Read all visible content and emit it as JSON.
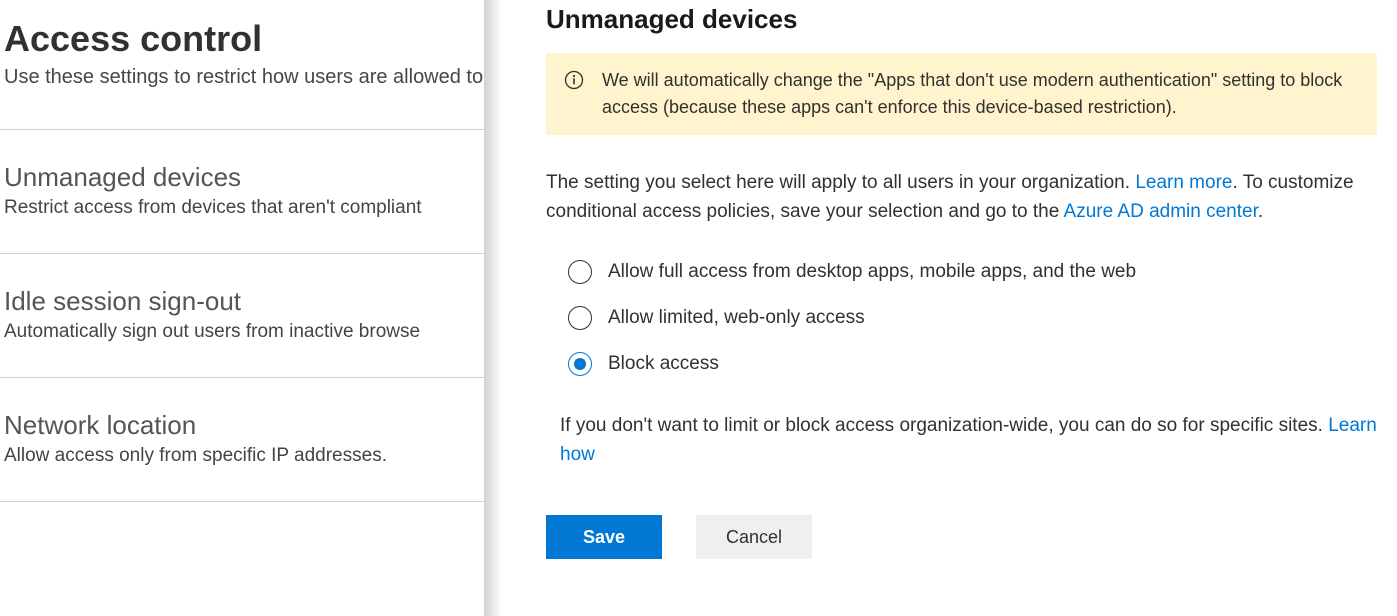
{
  "left": {
    "title": "Access control",
    "subtitle": "Use these settings to restrict how users are allowed to",
    "sections": [
      {
        "title": "Unmanaged devices",
        "desc": "Restrict access from devices that aren't compliant"
      },
      {
        "title": "Idle session sign-out",
        "desc": "Automatically sign out users from inactive browse"
      },
      {
        "title": "Network location",
        "desc": "Allow access only from specific IP addresses."
      }
    ]
  },
  "panel": {
    "title": "Unmanaged devices",
    "info": "We will automatically change the \"Apps that don't use modern authentication\" setting to block access (because these apps can't enforce this device-based restriction).",
    "desc_part1": "The setting you select here will apply to all users in your organization. ",
    "learn_more": "Learn more",
    "desc_part2": ". To customize conditional access policies, save your selection and go to the ",
    "admin_link": "Azure AD admin center",
    "desc_part3": ".",
    "options": [
      {
        "label": "Allow full access from desktop apps, mobile apps, and the web",
        "selected": false
      },
      {
        "label": "Allow limited, web-only access",
        "selected": false
      },
      {
        "label": "Block access",
        "selected": true
      }
    ],
    "secondary_part1": "If you don't want to limit or block access organization-wide, you can do so for specific sites. ",
    "learn_how": "Learn how",
    "save": "Save",
    "cancel": "Cancel"
  }
}
